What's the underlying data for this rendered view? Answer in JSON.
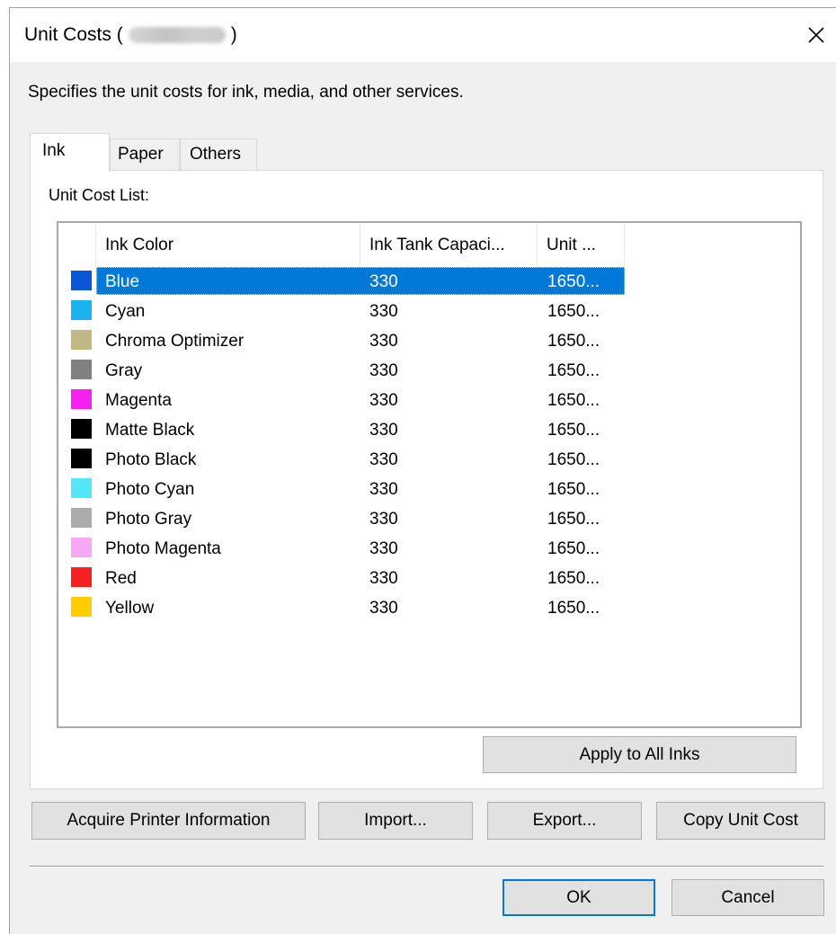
{
  "window": {
    "title_prefix": "Unit Costs (",
    "title_suffix": ")"
  },
  "description": "Specifies the unit costs for ink, media, and other services.",
  "tabs": [
    {
      "label": "Ink",
      "selected": true
    },
    {
      "label": "Paper",
      "selected": false
    },
    {
      "label": "Others",
      "selected": false
    }
  ],
  "unit_cost_list": {
    "label": "Unit Cost List:",
    "columns": [
      "Ink Color",
      "Ink Tank Capaci...",
      "Unit ..."
    ],
    "rows": [
      {
        "color_name": "Blue",
        "swatch": "#0a55d8",
        "capacity": "330",
        "unit": "1650...",
        "selected": true
      },
      {
        "color_name": "Cyan",
        "swatch": "#17b4f0",
        "capacity": "330",
        "unit": "1650...",
        "selected": false
      },
      {
        "color_name": "Chroma Optimizer",
        "swatch": "#c1b886",
        "capacity": "330",
        "unit": "1650...",
        "selected": false
      },
      {
        "color_name": "Gray",
        "swatch": "#808080",
        "capacity": "330",
        "unit": "1650...",
        "selected": false
      },
      {
        "color_name": "Magenta",
        "swatch": "#f51ff0",
        "capacity": "330",
        "unit": "1650...",
        "selected": false
      },
      {
        "color_name": "Matte Black",
        "swatch": "#000000",
        "capacity": "330",
        "unit": "1650...",
        "selected": false
      },
      {
        "color_name": "Photo Black",
        "swatch": "#000000",
        "capacity": "330",
        "unit": "1650...",
        "selected": false
      },
      {
        "color_name": "Photo Cyan",
        "swatch": "#55e6f7",
        "capacity": "330",
        "unit": "1650...",
        "selected": false
      },
      {
        "color_name": "Photo Gray",
        "swatch": "#ababab",
        "capacity": "330",
        "unit": "1650...",
        "selected": false
      },
      {
        "color_name": "Photo Magenta",
        "swatch": "#f7a7f4",
        "capacity": "330",
        "unit": "1650...",
        "selected": false
      },
      {
        "color_name": "Red",
        "swatch": "#f52121",
        "capacity": "330",
        "unit": "1650...",
        "selected": false
      },
      {
        "color_name": "Yellow",
        "swatch": "#ffcc00",
        "capacity": "330",
        "unit": "1650...",
        "selected": false
      }
    ]
  },
  "buttons": {
    "apply_all": "Apply to All Inks",
    "acquire": "Acquire Printer Information",
    "import": "Import...",
    "export": "Export...",
    "copy_unit_cost": "Copy Unit Cost",
    "ok": "OK",
    "cancel": "Cancel"
  },
  "colors": {
    "selection": "#0078d7",
    "dialog_bg": "#f0f0f0",
    "button_bg": "#e1e1e1"
  },
  "icons": {
    "close": "close-icon"
  }
}
